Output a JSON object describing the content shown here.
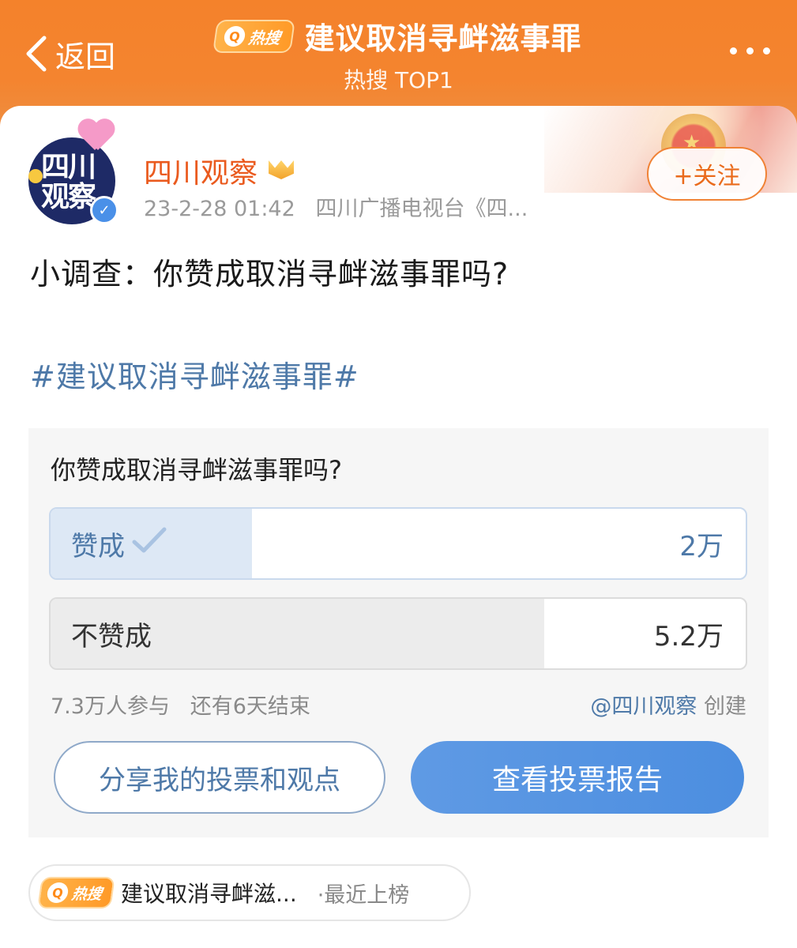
{
  "header": {
    "back_label": "返回",
    "hot_badge": "热搜",
    "title": "建议取消寻衅滋事罪",
    "subtitle": "热搜 TOP1"
  },
  "post": {
    "author": "四川观察",
    "avatar_text_1": "四川",
    "avatar_text_2": "观察",
    "time": "23-2-28 01:42",
    "source": "四川广播电视台《四...",
    "follow_label": "+关注",
    "text": "小调查：你赞成取消寻衅滋事罪吗?",
    "hashtag": "#建议取消寻衅滋事罪#"
  },
  "poll": {
    "question": "你赞成取消寻衅滋事罪吗?",
    "options": [
      {
        "label": "赞成",
        "count": "2万",
        "fraction": 0.29,
        "selected": true
      },
      {
        "label": "不赞成",
        "count": "5.2万",
        "fraction": 0.71,
        "selected": false
      }
    ],
    "participants": "7.3万人参与",
    "remaining": "还有6天结束",
    "creator": "@四川观察",
    "created_suffix": "创建",
    "share_label": "分享我的投票和观点",
    "report_label": "查看投票报告"
  },
  "hot_chip": {
    "badge": "热搜",
    "title": "建议取消寻衅滋...",
    "tag": "·最近上榜"
  },
  "colors": {
    "header_orange": "#f4822b",
    "name_orange": "#ea5a1e",
    "link_blue": "#4e79a8",
    "button_blue": "#5f9ae4"
  }
}
